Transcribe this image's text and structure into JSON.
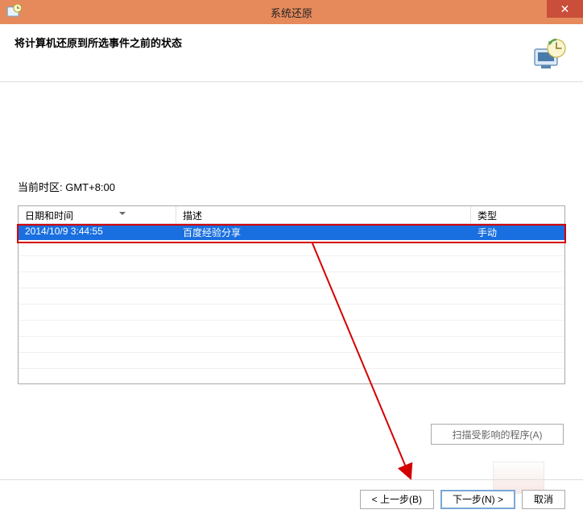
{
  "titlebar": {
    "title": "系统还原"
  },
  "header": {
    "text": "将计算机还原到所选事件之前的状态"
  },
  "timezone": {
    "label": "当前时区: GMT+8:00"
  },
  "table": {
    "headers": {
      "datetime": "日期和时间",
      "description": "描述",
      "type": "类型"
    },
    "rows": [
      {
        "datetime": "2014/10/9 3:44:55",
        "description": "百度经验分享",
        "type": "手动"
      }
    ]
  },
  "buttons": {
    "scan": "扫描受影响的程序(A)",
    "back": "< 上一步(B)",
    "next": "下一步(N) >",
    "cancel": "取消"
  }
}
